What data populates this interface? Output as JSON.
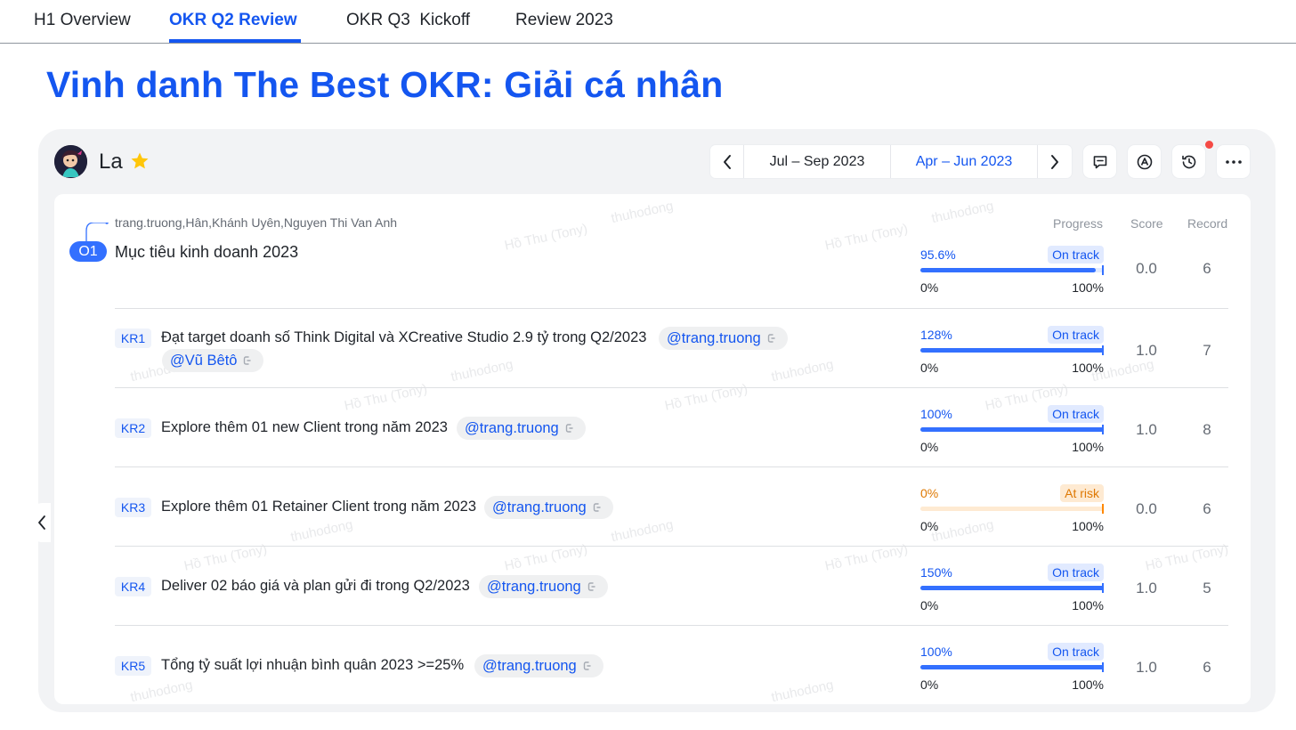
{
  "tabs": [
    {
      "label": "H1 Overview"
    },
    {
      "label": "OKR Q2 Review"
    },
    {
      "label": "OKR Q3  Kickoff"
    },
    {
      "label": "Review 2023"
    }
  ],
  "page_title": "Vinh danh The Best OKR: Giải cá nhân",
  "owner": {
    "name": "La"
  },
  "period": {
    "first": "Jul – Sep 2023",
    "second": "Apr – Jun 2023",
    "selected": "Apr – Jun 2023"
  },
  "columns": {
    "progress": "Progress",
    "score": "Score",
    "record": "Record"
  },
  "watermark": {
    "name": "Hồ Thu (Tony)",
    "handle": "thuhodong"
  },
  "objective": {
    "assignees": "trang.truong,Hân,Khánh Uyên,Nguyen Thi Van Anh",
    "badge": "O1",
    "title": "Mục tiêu kinh doanh 2023",
    "progress": {
      "pct": "95.6%",
      "value": 0.956,
      "status": "On track",
      "min": "0%",
      "max": "100%"
    },
    "score": "0.0",
    "record": "6"
  },
  "key_results": [
    {
      "badge": "KR1",
      "title": "Đạt target doanh số Think Digital và XCreative Studio 2.9 tỷ trong Q2/2023",
      "mentions": [
        "@trang.truong",
        "@Vũ Bêtô"
      ],
      "progress": {
        "pct": "128%",
        "value": 1.0,
        "status": "On track",
        "min": "0%",
        "max": "100%"
      },
      "score": "1.0",
      "record": "7"
    },
    {
      "badge": "KR2",
      "title": "Explore thêm 01 new Client trong năm 2023",
      "mentions": [
        "@trang.truong"
      ],
      "progress": {
        "pct": "100%",
        "value": 1.0,
        "status": "On track",
        "min": "0%",
        "max": "100%"
      },
      "score": "1.0",
      "record": "8"
    },
    {
      "badge": "KR3",
      "title": "Explore thêm 01 Retainer Client trong năm 2023",
      "mentions": [
        "@trang.truong"
      ],
      "progress": {
        "pct": "0%",
        "value": 0.0,
        "status": "At risk",
        "min": "0%",
        "max": "100%"
      },
      "score": "0.0",
      "record": "6"
    },
    {
      "badge": "KR4",
      "title": "Deliver 02 báo giá và plan gửi đi trong Q2/2023",
      "mentions": [
        "@trang.truong"
      ],
      "progress": {
        "pct": "150%",
        "value": 1.0,
        "status": "On track",
        "min": "0%",
        "max": "100%"
      },
      "score": "1.0",
      "record": "5"
    },
    {
      "badge": "KR5",
      "title": "Tổng tỷ suất lợi nhuận bình quân 2023 >=25%",
      "mentions": [
        "@trang.truong"
      ],
      "progress": {
        "pct": "100%",
        "value": 1.0,
        "status": "On track",
        "min": "0%",
        "max": "100%"
      },
      "score": "1.0",
      "record": "6"
    }
  ],
  "colors": {
    "accent": "#1456f0",
    "on_track": "#3370ff",
    "at_risk": "#ff8800"
  }
}
